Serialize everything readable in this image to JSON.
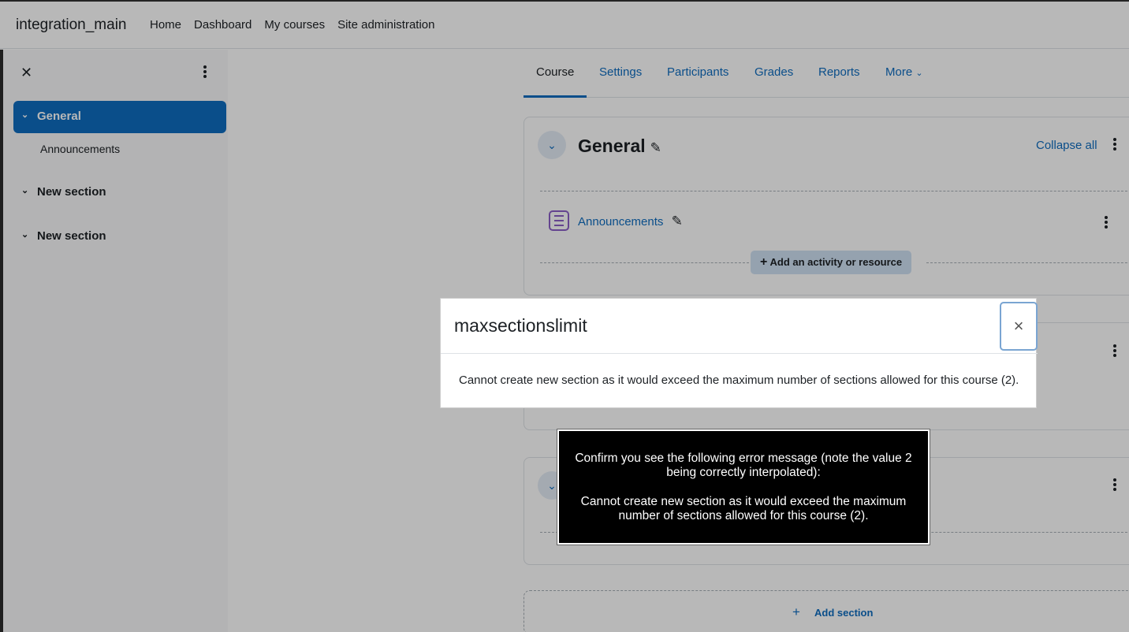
{
  "navbar": {
    "brand": "integration_main",
    "links": [
      "Home",
      "Dashboard",
      "My courses",
      "Site administration"
    ]
  },
  "drawer": {
    "close_icon": "close-icon",
    "items": [
      {
        "label": "General",
        "active": true
      },
      {
        "label": "Announcements",
        "sub": true
      },
      {
        "label": "New section"
      },
      {
        "label": "New section"
      }
    ]
  },
  "tabs": [
    "Course",
    "Settings",
    "Participants",
    "Grades",
    "Reports",
    "More"
  ],
  "general_section": {
    "title": "General",
    "collapse_all": "Collapse all",
    "activity": "Announcements",
    "add_activity": "Add an activity or resource"
  },
  "add_section": "Add section",
  "modal": {
    "title": "maxsectionslimit",
    "close": "×",
    "body": "Cannot create new section as it would exceed the maximum number of sections allowed for this course (2)."
  },
  "tooltip": {
    "instruction": "Confirm you see the following error message (note the value 2 being correctly interpolated):",
    "message": "Cannot create new section as it would exceed the maximum number of sections allowed for this course (2)."
  },
  "colors": {
    "accent": "#0f6cbf",
    "activity_icon": "#8b5fc7"
  }
}
